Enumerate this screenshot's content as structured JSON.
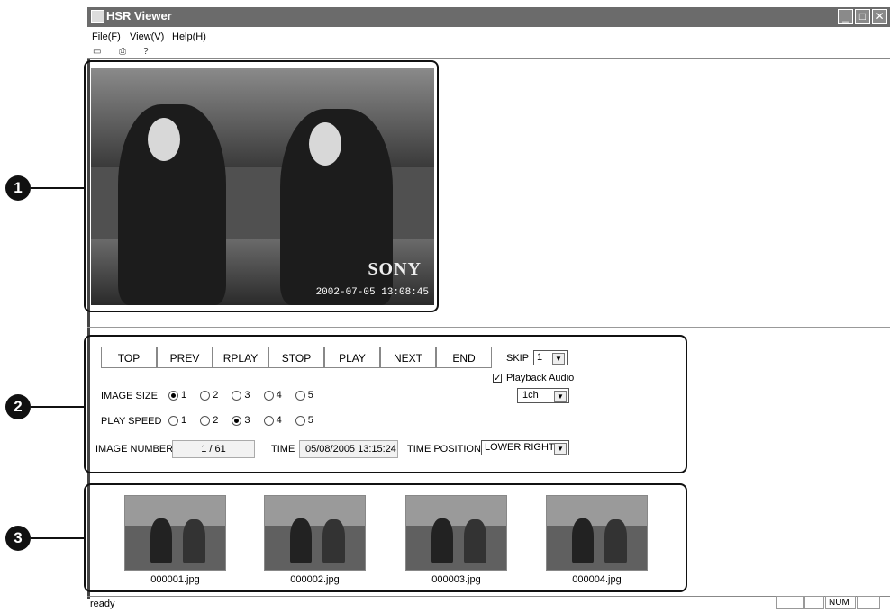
{
  "window": {
    "title": "HSR Viewer",
    "minimize_icon": "minimize-icon",
    "maximize_icon": "maximize-icon",
    "close_icon": "close-icon"
  },
  "menu": [
    "File(F)",
    "View(V)",
    "Help(H)"
  ],
  "toolbar_icons": [
    "open-icon",
    "print-icon",
    "help-icon"
  ],
  "video": {
    "brand": "SONY",
    "timestamp": "2002-07-05 13:08:45"
  },
  "callouts": [
    "1",
    "2",
    "3"
  ],
  "controls": {
    "buttons": [
      "TOP",
      "PREV",
      "RPLAY",
      "STOP",
      "PLAY",
      "NEXT",
      "END"
    ],
    "skip": {
      "label": "SKIP",
      "value": "1"
    },
    "playback_audio": {
      "label": "Playback Audio",
      "checked": true
    },
    "channel": {
      "value": "1ch"
    },
    "image_size": {
      "label": "IMAGE SIZE",
      "options": [
        "1",
        "2",
        "3",
        "4",
        "5"
      ],
      "selected": "1"
    },
    "play_speed": {
      "label": "PLAY SPEED",
      "options": [
        "1",
        "2",
        "3",
        "4",
        "5"
      ],
      "selected": "3"
    },
    "image_number": {
      "label": "IMAGE NUMBER",
      "value": "1 / 61"
    },
    "time": {
      "label": "TIME",
      "value": "05/08/2005 13:15:24"
    },
    "time_position": {
      "label": "TIME POSITION",
      "value": "LOWER RIGHT"
    }
  },
  "thumbnails": [
    "000001.jpg",
    "000002.jpg",
    "000003.jpg",
    "000004.jpg"
  ],
  "status": {
    "text": "ready",
    "num": "NUM"
  }
}
